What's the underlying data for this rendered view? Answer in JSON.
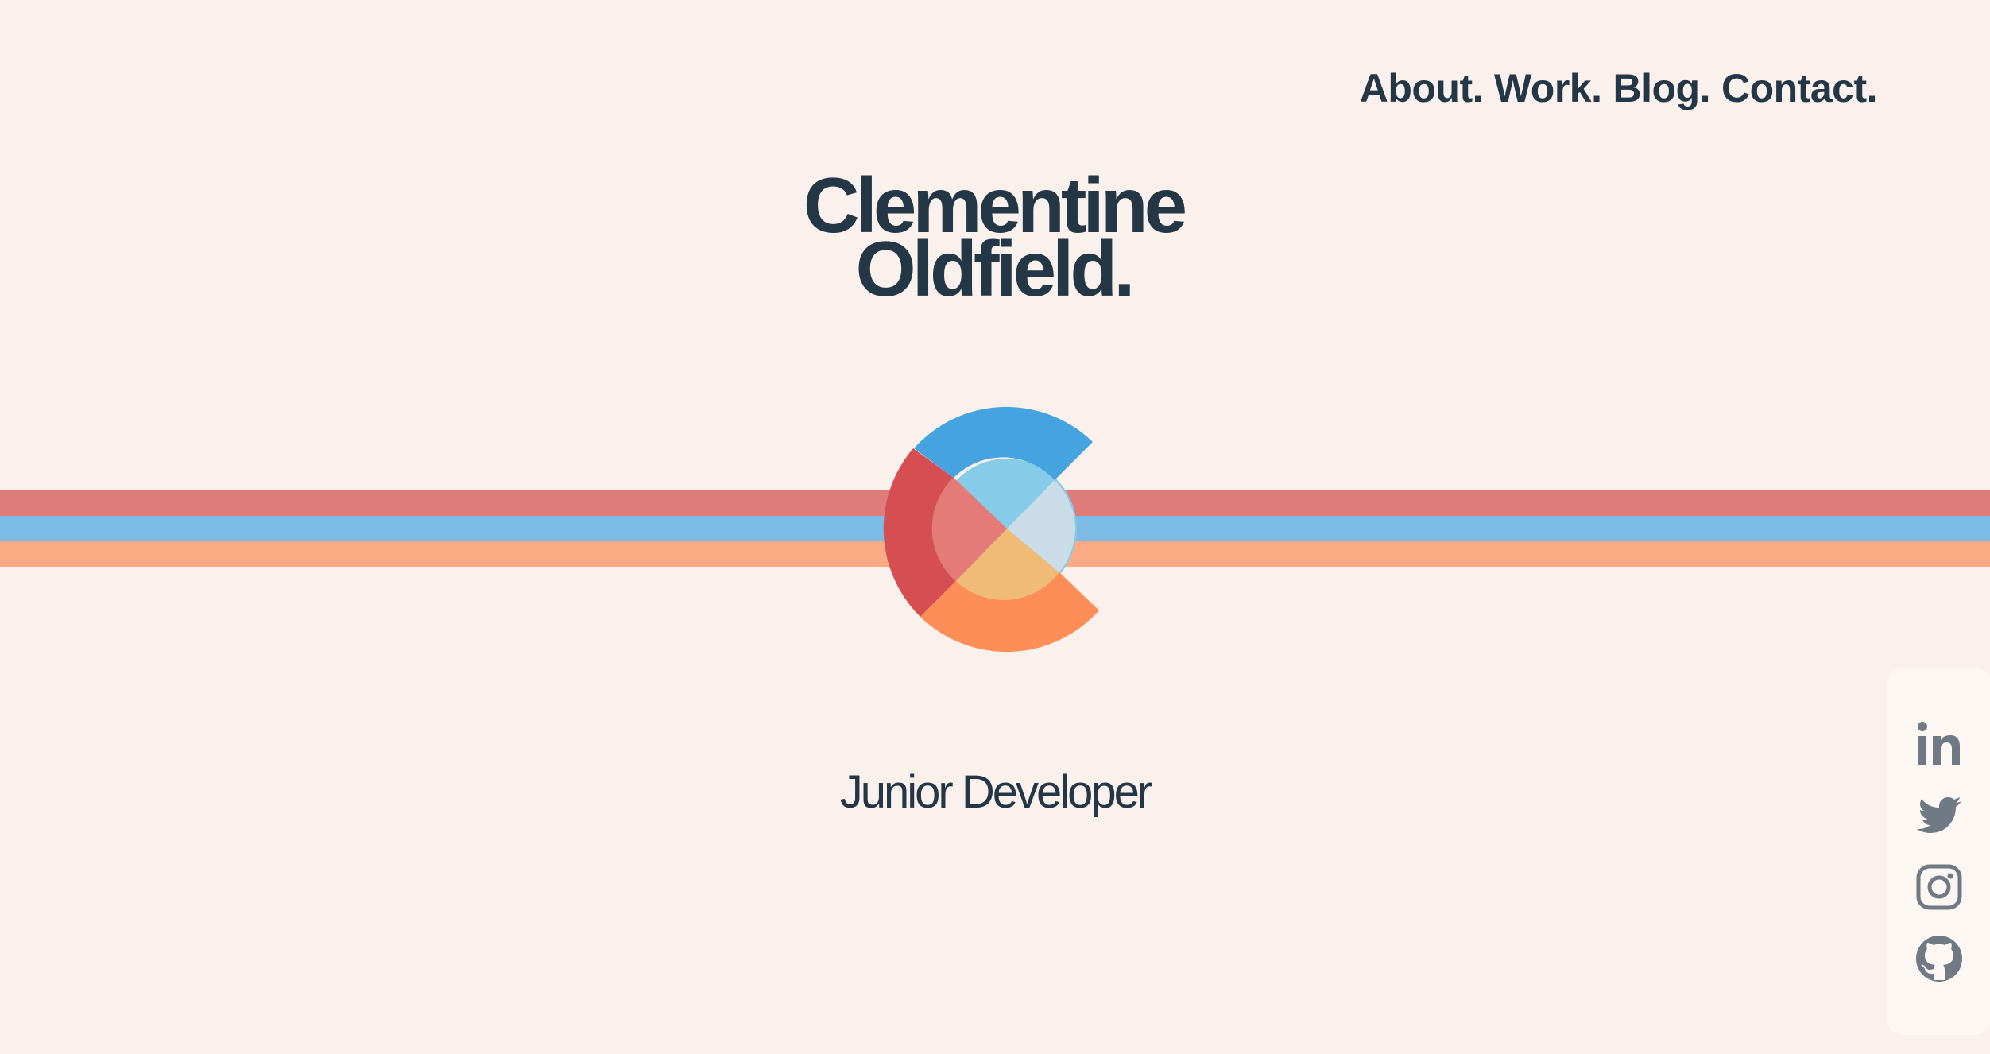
{
  "nav": {
    "items": [
      {
        "label": "About."
      },
      {
        "label": "Work."
      },
      {
        "label": "Blog."
      },
      {
        "label": "Contact."
      }
    ]
  },
  "hero": {
    "name_line1": "Clementine",
    "name_line2": "Oldfield.",
    "subtitle": "Junior Developer"
  },
  "social": {
    "icons": [
      "linkedin-icon",
      "twitter-icon",
      "instagram-icon",
      "github-icon"
    ]
  },
  "colors": {
    "background": "#fbf1ec",
    "text": "#243746",
    "stripe_red": "#de7b7b",
    "stripe_blue": "#7cbbe6",
    "stripe_orange": "#fcab85",
    "logo_blue": "#45a3df",
    "logo_red": "#d54f52",
    "logo_orange": "#fe8e58",
    "icon_gray": "#6f7a85"
  }
}
